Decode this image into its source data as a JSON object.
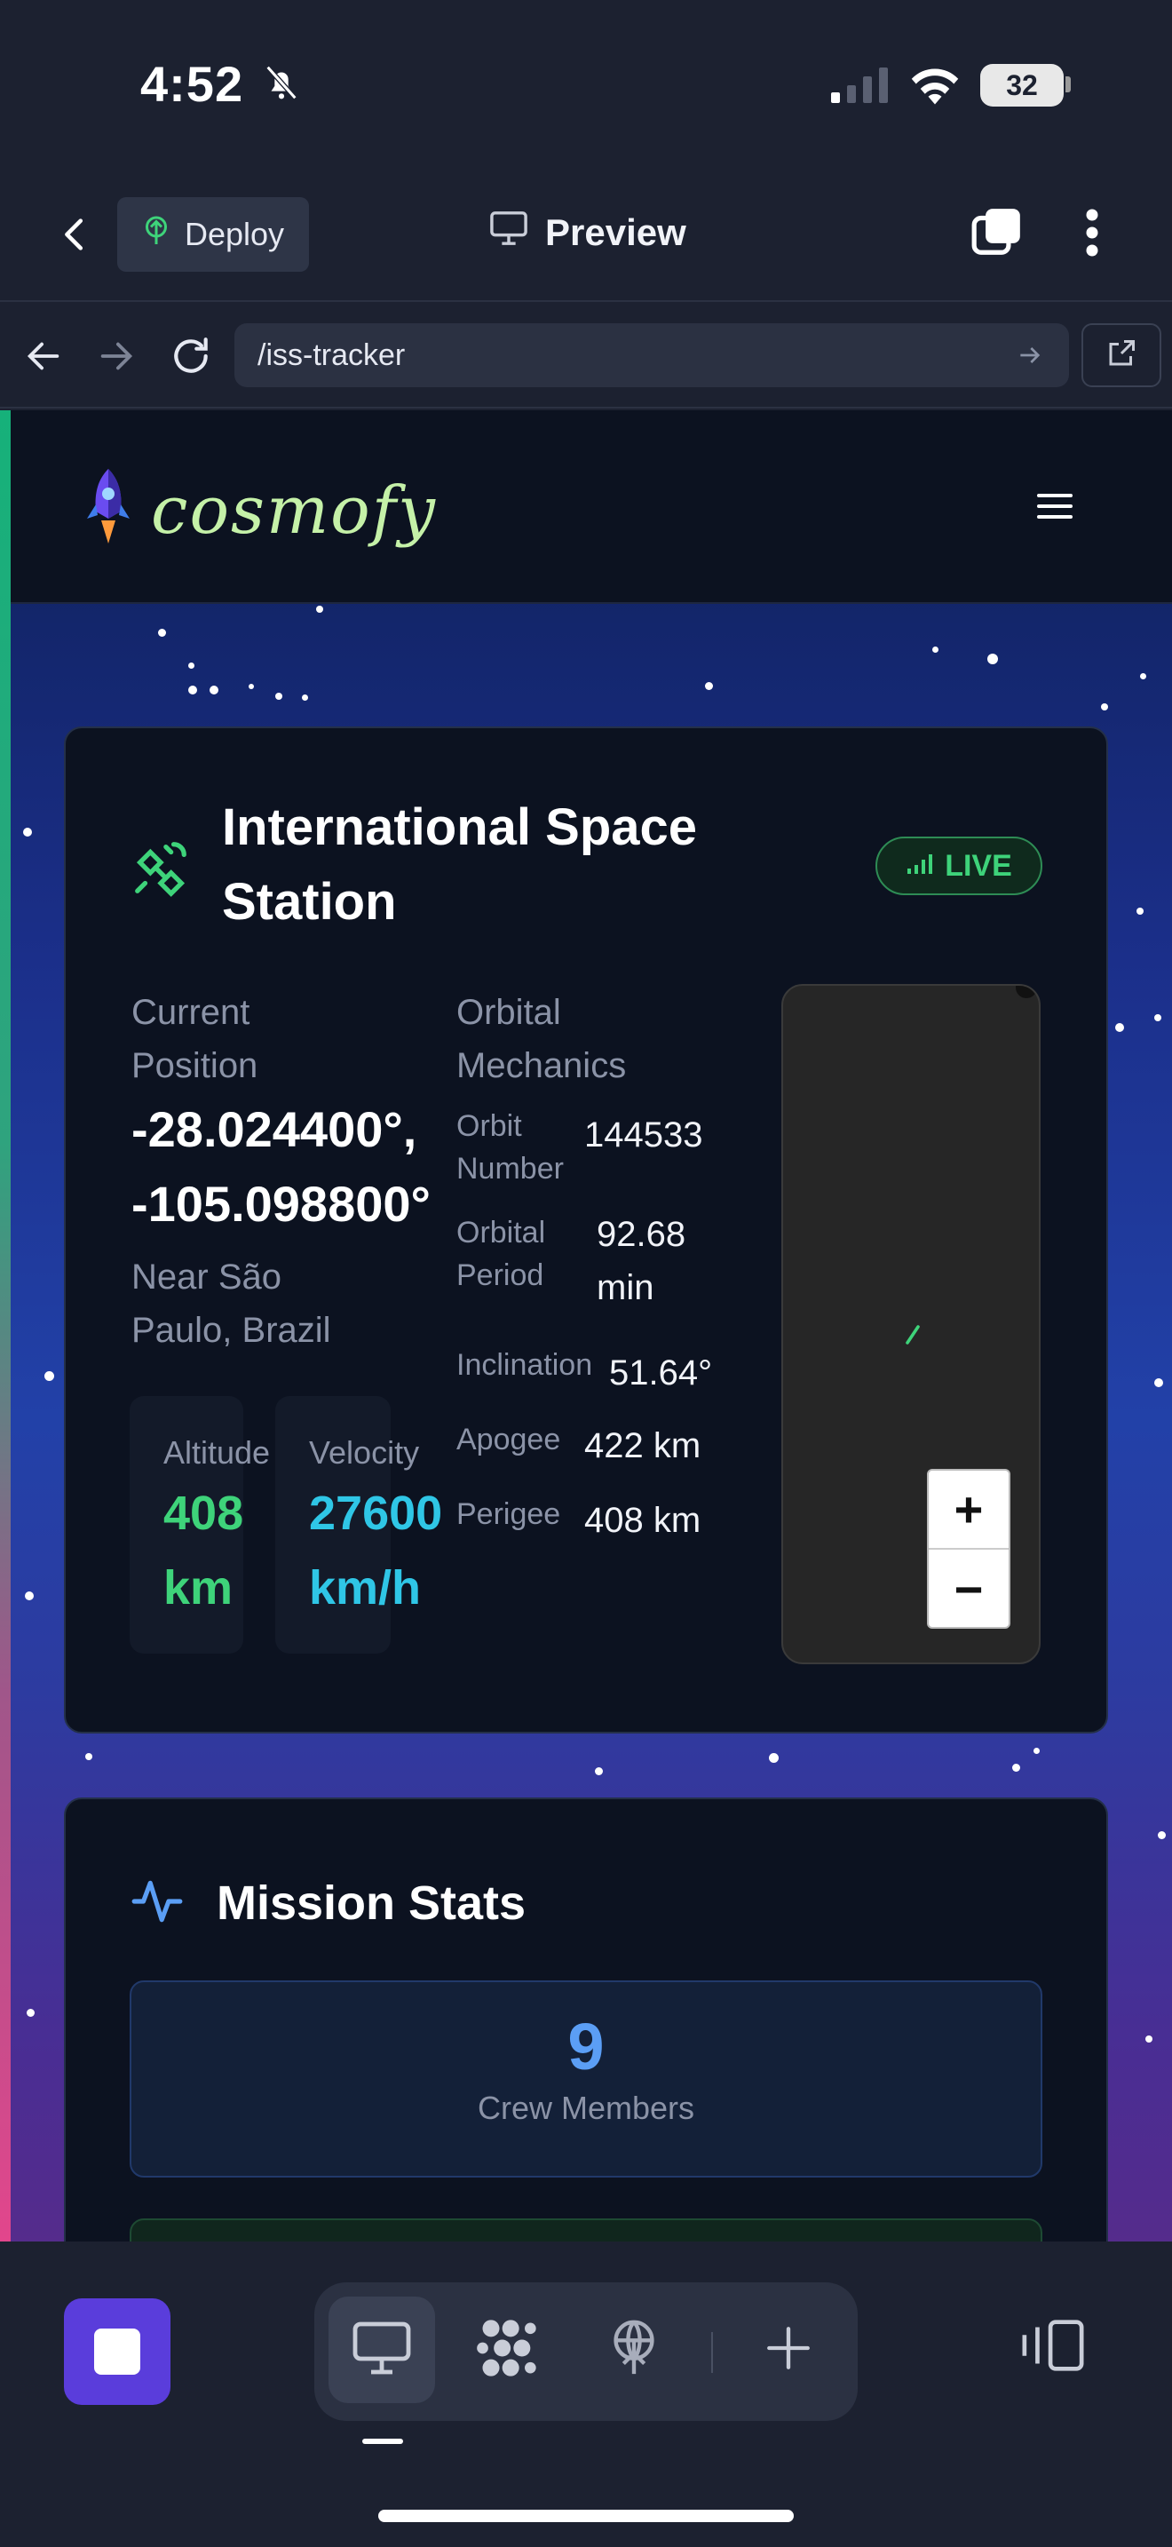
{
  "status": {
    "time": "4:52",
    "battery": "32"
  },
  "topbar": {
    "deploy_label": "Deploy",
    "preview_label": "Preview"
  },
  "urlbar": {
    "path": "/iss-tracker"
  },
  "site": {
    "brand": "cosmofy"
  },
  "iss_card": {
    "title_line1": "International Space",
    "title_line2": "Station",
    "live_label": "LIVE",
    "position_label_1": "Current",
    "position_label_2": "Position",
    "latitude": "-28.024400°,",
    "longitude": "-105.098800°",
    "near_1": "Near São",
    "near_2": "Paulo, Brazil",
    "altitude": {
      "label": "Altitude",
      "value": "408",
      "unit": "km"
    },
    "velocity": {
      "label": "Velocity",
      "value": "27600",
      "unit": "km/h"
    },
    "orbital_heading_1": "Orbital",
    "orbital_heading_2": "Mechanics",
    "orbit_number": {
      "label_1": "Orbit",
      "label_2": "Number",
      "value": "144533"
    },
    "orbital_period": {
      "label_1": "Orbital",
      "label_2": "Period",
      "value_1": "92.68",
      "value_2": "min"
    },
    "inclination": {
      "label": "Inclination",
      "value": "51.64°"
    },
    "apogee": {
      "label": "Apogee",
      "value": "422 km"
    },
    "perigee": {
      "label": "Perigee",
      "value": "408 km"
    },
    "zoom_in": "+",
    "zoom_out": "−"
  },
  "mission_stats": {
    "title": "Mission Stats",
    "crew_count": "9",
    "crew_label": "Crew Members"
  },
  "colors": {
    "accent_green": "#3ed37a",
    "accent_cyan": "#2fc6e6",
    "accent_blue": "#5b9ef5"
  }
}
